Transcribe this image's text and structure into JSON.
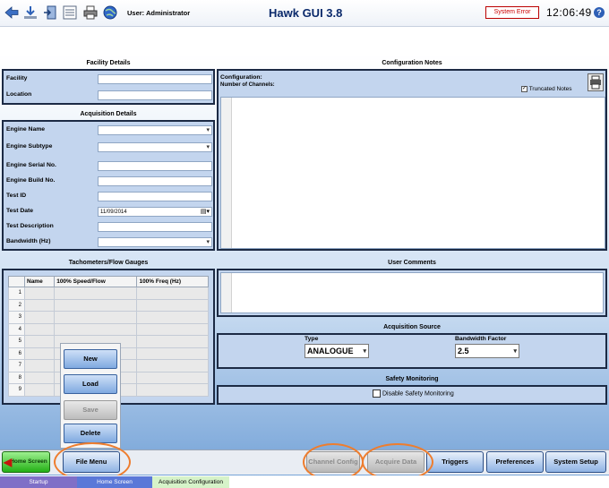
{
  "header": {
    "user": "User: Administrator",
    "title": "Hawk GUI 3.8",
    "status": "System Error",
    "clock": "12:06:49",
    "help_glyph": "?"
  },
  "toolbar_icons": [
    "back-arrow-icon",
    "download-icon",
    "exit-door-icon",
    "list-icon",
    "print-icon",
    "globe-icon"
  ],
  "facility": {
    "title": "Facility Details",
    "fields": [
      {
        "label": "Facility",
        "value": ""
      },
      {
        "label": "Location",
        "value": ""
      }
    ]
  },
  "acquisition": {
    "title": "Acquisition Details",
    "fields": [
      {
        "label": "Engine Name",
        "value": ""
      },
      {
        "label": "Engine Subtype",
        "value": ""
      },
      {
        "label": "Engine Serial No.",
        "value": ""
      },
      {
        "label": "Engine Build No.",
        "value": ""
      },
      {
        "label": "Test ID",
        "value": ""
      },
      {
        "label": "Test Date",
        "value": "11/09/2014"
      },
      {
        "label": "Test Description",
        "value": ""
      },
      {
        "label": "Bandwidth (Hz)",
        "value": ""
      }
    ]
  },
  "config_notes": {
    "title": "Configuration Notes",
    "line1": "Configuration:",
    "line2": "Number of Channels:",
    "truncated_label": "Truncated Notes",
    "truncated_checked": true
  },
  "tach": {
    "title": "Tachometers/Flow Gauges",
    "columns": [
      "Name",
      "100% Speed/Flow",
      "100% Freq (Hz)"
    ],
    "rows": [
      "1",
      "2",
      "3",
      "4",
      "5",
      "6",
      "7",
      "8",
      "9"
    ]
  },
  "user_comments": {
    "title": "User Comments"
  },
  "acq_source": {
    "title": "Acquisition Source",
    "type_label": "Type",
    "type_value": "ANALOGUE",
    "bw_label": "Bandwidth Factor",
    "bw_value": "2.5"
  },
  "safety": {
    "title": "Safety Monitoring",
    "checkbox_label": "Disable Safety Monitoring",
    "checked": false
  },
  "file_menu": {
    "items": [
      {
        "label": "New",
        "enabled": true
      },
      {
        "label": "Load",
        "enabled": true
      },
      {
        "label": "Save",
        "enabled": false
      },
      {
        "label": "Delete",
        "enabled": true
      }
    ]
  },
  "bottom_bar": {
    "home": "Home Screen",
    "file_menu": "File Menu",
    "channel_config": "Channel Config",
    "acquire_data": "Acquire Data",
    "triggers": "Triggers",
    "preferences": "Preferences",
    "system_setup": "System Setup"
  },
  "tabs": [
    "Startup",
    "Home Screen",
    "Acquisition Configuration"
  ],
  "colors": {
    "accent": "#ee7d2e",
    "title": "#0b2a6b",
    "error": "#cc0000"
  }
}
